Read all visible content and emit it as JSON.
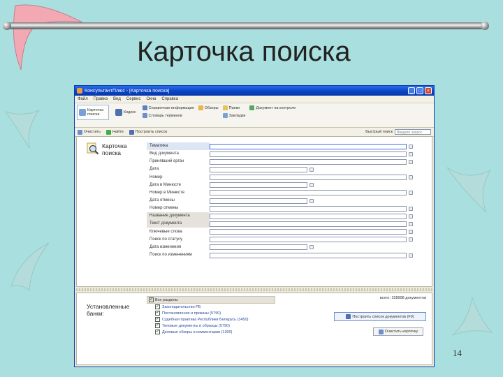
{
  "slide": {
    "title": "Карточка поиска",
    "page_number": "14"
  },
  "window": {
    "title": "КонсультантПлюс - [Карточка поиска]",
    "menu": [
      "Файл",
      "Правка",
      "Вид",
      "Сервис",
      "Окна",
      "Справка"
    ],
    "toolbar": {
      "big": [
        "Карточка поиска",
        "Кодекс"
      ],
      "col1": [
        "Справочная информация",
        "Словарь терминов"
      ],
      "col2": [
        "Обзоры"
      ],
      "col3": [
        "Папки",
        "Закладки"
      ],
      "col4": [
        "Документ на контроле"
      ]
    },
    "toolbar2": {
      "items": [
        "Очистить",
        "Найти",
        "Построить список"
      ],
      "right_label": "Быстрый поиск",
      "select_placeholder": "Введите запрос"
    }
  },
  "search_card": {
    "title": "Карточка\nпоиска",
    "fields": [
      {
        "label": "Тематика",
        "width": "long",
        "style": "hl",
        "selected": true
      },
      {
        "label": "Вид документа",
        "width": "long",
        "style": "",
        "selected": false
      },
      {
        "label": "Принявший орган",
        "width": "long",
        "style": "",
        "selected": false
      },
      {
        "label": "Дата",
        "width": "short",
        "style": "",
        "selected": false
      },
      {
        "label": "Номер",
        "width": "long",
        "style": "",
        "selected": false
      },
      {
        "label": "Дата в Минюсте",
        "width": "short",
        "style": "",
        "selected": false
      },
      {
        "label": "Номер в Минюсте",
        "width": "long",
        "style": "",
        "selected": false
      },
      {
        "label": "Дата отмены",
        "width": "short",
        "style": "",
        "selected": false
      },
      {
        "label": "Номер отмены",
        "width": "long",
        "style": "",
        "selected": false
      },
      {
        "label": "Название документа",
        "width": "long",
        "style": "gray",
        "selected": false
      },
      {
        "label": "Текст документа",
        "width": "long",
        "style": "gray",
        "selected": false
      },
      {
        "label": "Ключевые слова",
        "width": "long",
        "style": "",
        "selected": false
      },
      {
        "label": "Поиск по статусу",
        "width": "long",
        "style": "",
        "selected": false
      },
      {
        "label": "Дата изменения",
        "width": "short",
        "style": "",
        "selected": false
      },
      {
        "label": "Поиск по изменениям",
        "width": "long",
        "style": "",
        "selected": false
      }
    ]
  },
  "bases": {
    "title": "Установленные\nбанки:",
    "header": "Все разделы",
    "items": [
      "Законодательство РБ",
      "Постановления и приказы (5790)",
      "Судебная практика Республики Беларусь (3450)",
      "Типовые документы и образцы (5790)",
      "Деловые обзоры и комментарии (1300)"
    ],
    "doc_count": "всего: 158998 документов",
    "build_list_label": "Построить список документов (F9)",
    "clear_label": "Очистить карточку"
  },
  "colors": {
    "background": "#a9e0df",
    "boomerang": "#f3a9b4",
    "titlebar": "#0a44c8"
  }
}
